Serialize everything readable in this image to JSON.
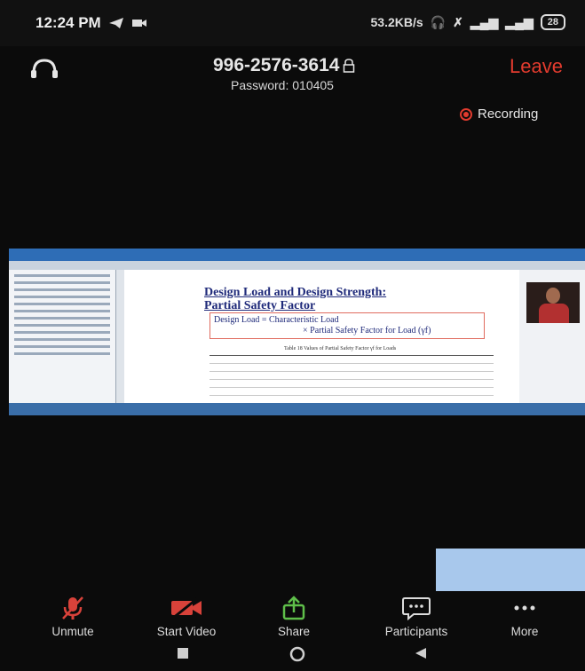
{
  "status_bar": {
    "time": "12:24 PM",
    "network_speed": "53.2KB/s",
    "battery": "28"
  },
  "meeting": {
    "id": "996-2576-3614",
    "password": "Password: 010405",
    "leave_label": "Leave",
    "recording_label": "Recording"
  },
  "shared_screen": {
    "slide_title_line1": "Design Load and Design Strength:",
    "slide_title_line2": "Partial Safety Factor",
    "formula_line1": "Design Load = Characteristic Load",
    "formula_line2": "× Partial Safety Factor for Load (γf)",
    "table_caption": "Table 18 Values of Partial Safety Factor γf for Loads"
  },
  "controls": [
    {
      "label": "Unmute",
      "icon": "microphone-muted-icon"
    },
    {
      "label": "Start Video",
      "icon": "video-off-icon"
    },
    {
      "label": "Share",
      "icon": "share-icon"
    },
    {
      "label": "Participants",
      "icon": "participants-icon"
    },
    {
      "label": "More",
      "icon": "more-icon"
    }
  ],
  "colors": {
    "leave": "#e23b2e",
    "recording_dot": "#e23b2e",
    "muted_red": "#d8423a",
    "share_green": "#5fbf4a",
    "tile_blue": "#a8c8ec"
  }
}
